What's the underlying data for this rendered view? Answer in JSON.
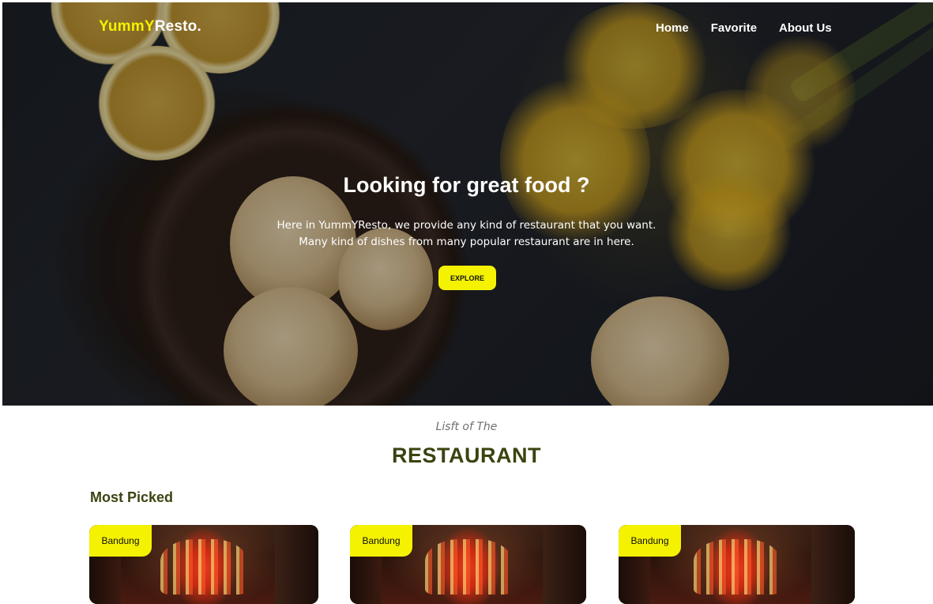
{
  "nav": {
    "brand_accent": "YummY",
    "brand_rest": "Resto.",
    "links": [
      "Home",
      "Favorite",
      "About Us"
    ]
  },
  "hero": {
    "title": "Looking for great food ?",
    "desc_line1": "Here in YummYResto, we provide any kind of restaurant that you want.",
    "desc_line2": "Many kind of dishes from many popular restaurant are in here.",
    "cta_label": "EXPLORE"
  },
  "section": {
    "subheading": "Lisft of The",
    "heading": "RESTAURANT",
    "group_title": "Most Picked"
  },
  "cards": [
    {
      "city": "Bandung"
    },
    {
      "city": "Bandung"
    },
    {
      "city": "Bandung"
    }
  ],
  "colors": {
    "accent": "#f4f200",
    "heading": "#3a4410"
  }
}
